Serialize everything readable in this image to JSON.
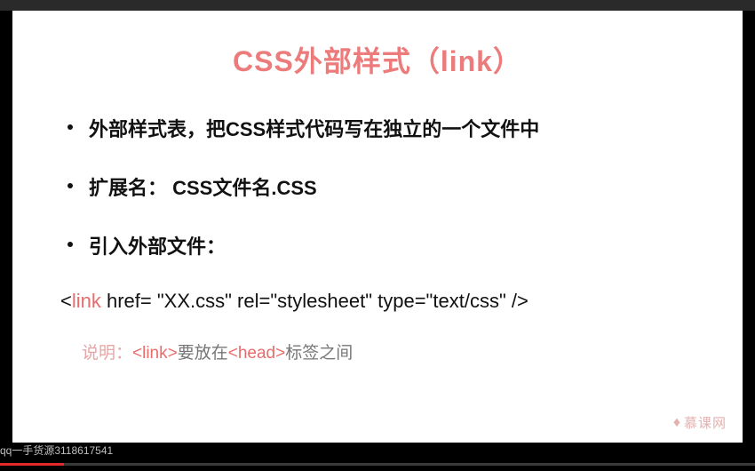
{
  "slide": {
    "title": "CSS外部样式（link）",
    "bullets": [
      "外部样式表，把CSS样式代码写在独立的一个文件中",
      "扩展名： CSS文件名.CSS",
      "引入外部文件："
    ],
    "code": {
      "open": "<",
      "keyword": "link",
      "rest": " href= \"XX.css\" rel=\"stylesheet\" type=\"text/css\" />"
    },
    "note": {
      "prefix": "说明：",
      "tag1": "<link>",
      "mid": "要放在",
      "tag2": "<head>",
      "suffix": "标签之间"
    },
    "brand": "慕课网"
  },
  "watermark": "qq一手货源3118617541",
  "progress_percent": 8.5
}
